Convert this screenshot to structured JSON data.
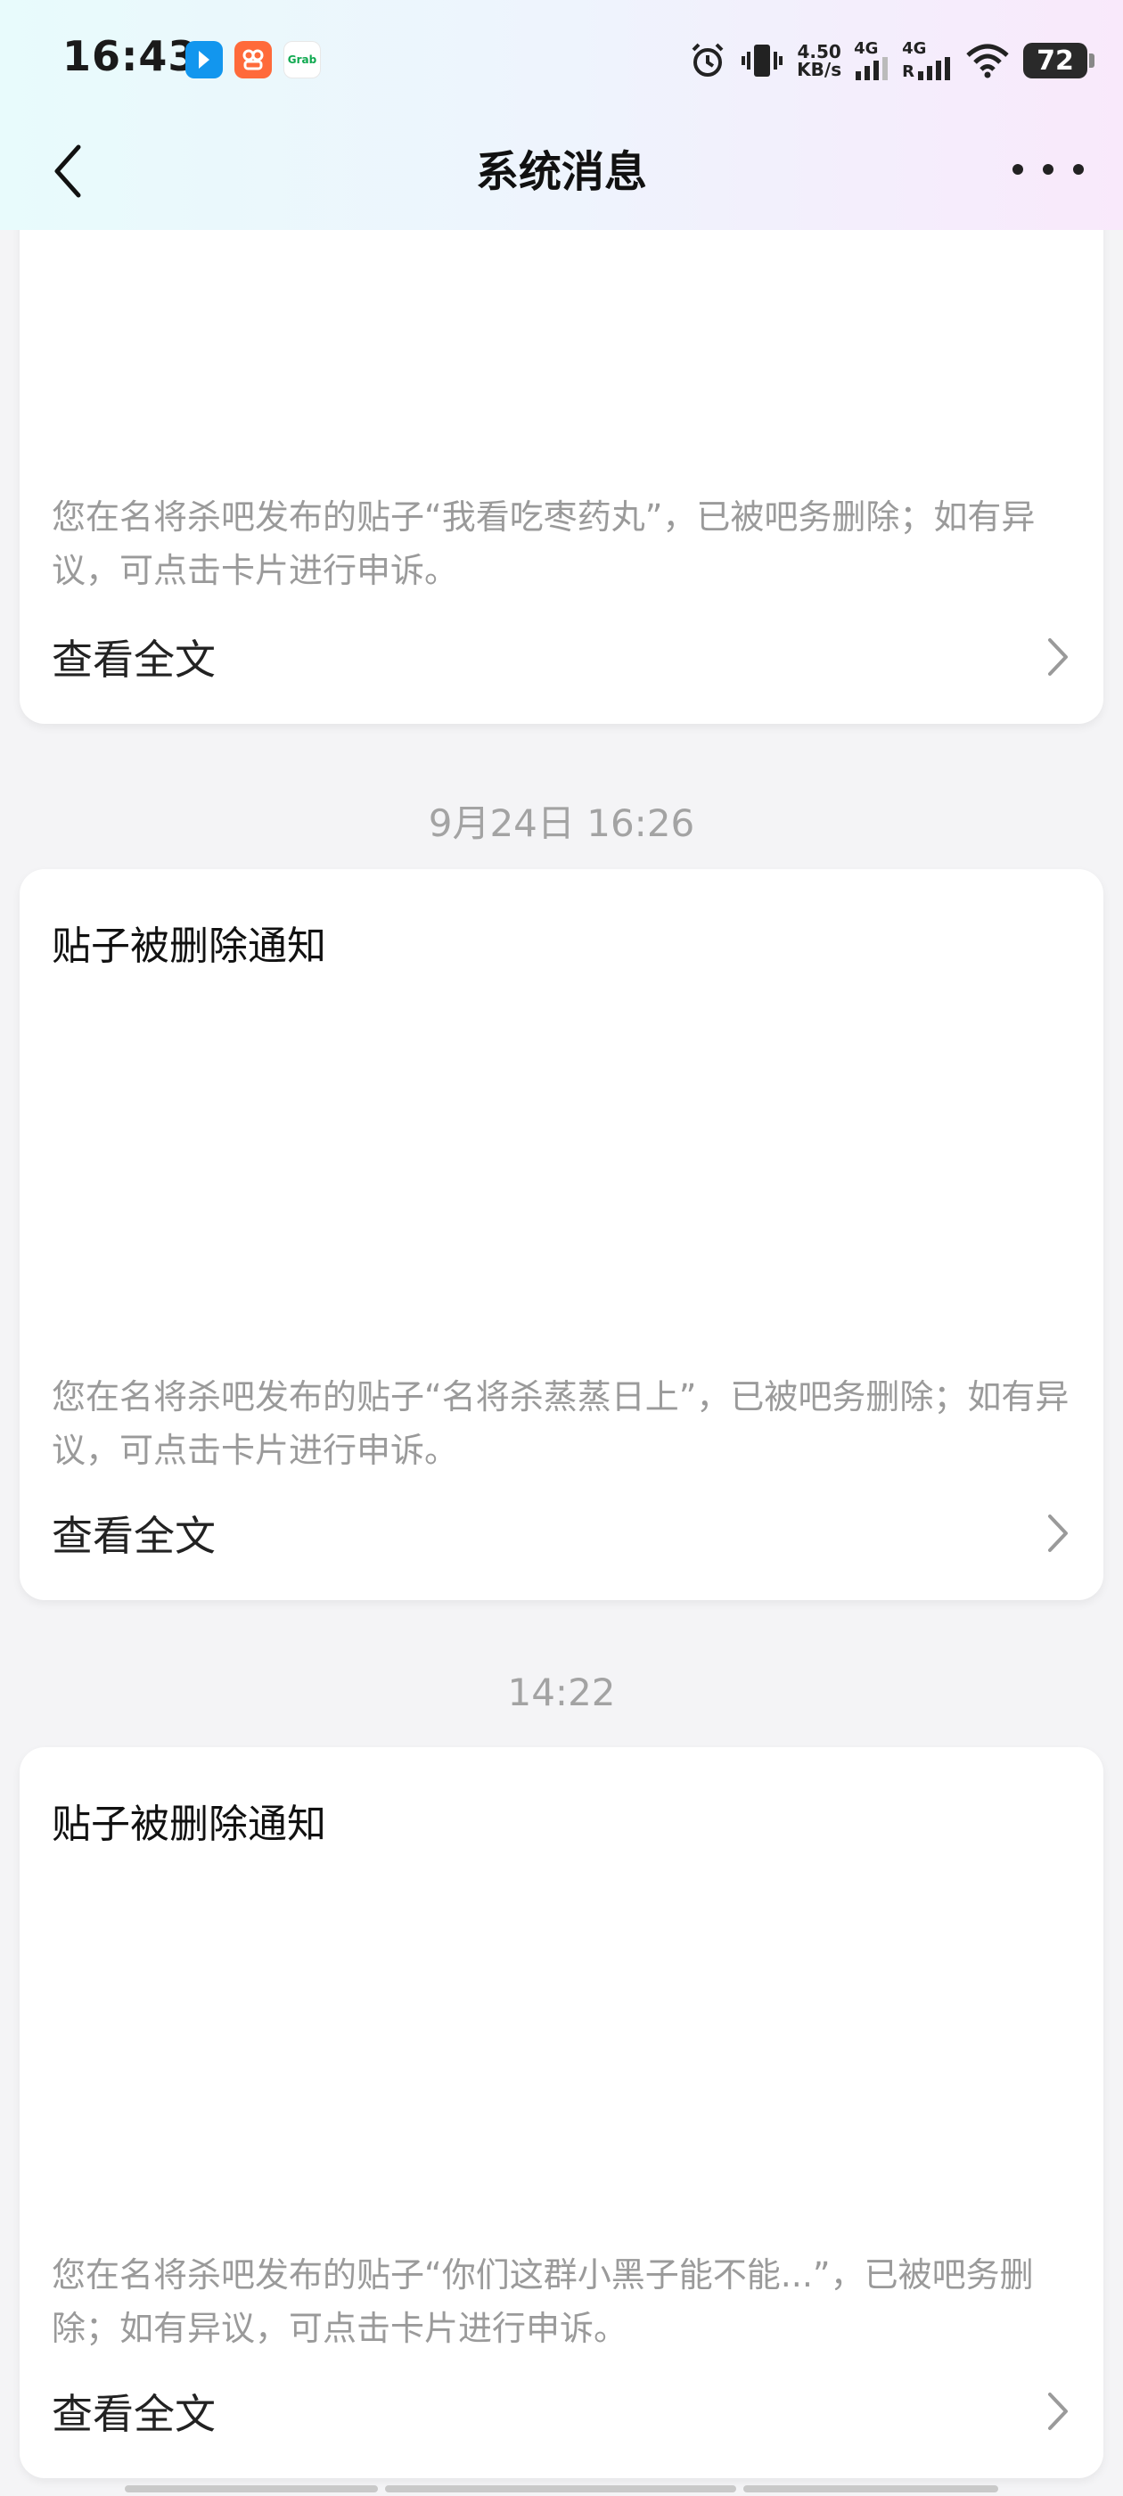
{
  "status_bar": {
    "time": "16:43",
    "apps": [
      "app-blue-icon",
      "app-orange-icon",
      "grab-icon"
    ],
    "grab_label": "Grab",
    "network_speed_value": "4.50",
    "network_speed_unit": "KB/s",
    "sim1_label": "4G",
    "sim2_label": "4G",
    "sim2_roaming": "R",
    "battery": "72"
  },
  "nav": {
    "title": "系统消息"
  },
  "messages": [
    {
      "body": "您在名将杀吧发布的贴子“我看吃枣药丸”，已被吧务删除；如有异议，可点击卡片进行申诉。",
      "link_label": "查看全文"
    },
    {
      "timestamp": "9月24日 16:26",
      "title": "贴子被删除通知",
      "body": "您在名将杀吧发布的贴子“名将杀蒸蒸日上”，已被吧务删除；如有异议，可点击卡片进行申诉。",
      "link_label": "查看全文"
    },
    {
      "timestamp": "14:22",
      "title": "贴子被删除通知",
      "body": "您在名将杀吧发布的贴子“你们这群小黑子能不能...”，已被吧务删除；如有异议，可点击卡片进行申诉。",
      "link_label": "查看全文"
    }
  ]
}
